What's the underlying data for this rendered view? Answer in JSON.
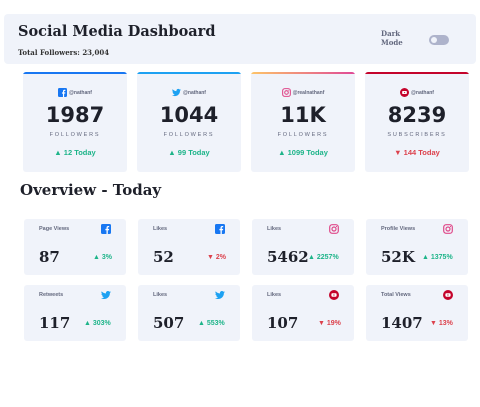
{
  "header": {
    "title": "Social Media Dashboard",
    "total_followers": "Total Followers: 23,004",
    "dark_mode_label": "Dark Mode"
  },
  "colors": {
    "facebook": "#1877f2",
    "twitter": "#1da1f2",
    "instagram": "#df4a8a",
    "youtube": "#c4032b",
    "up": "#1db489",
    "down": "#dc414c",
    "card_bg": "#f0f3fa"
  },
  "cards": [
    {
      "network": "facebook",
      "icon": "facebook-icon",
      "handle": "@nathanf",
      "count": "1987",
      "unit": "FOLLOWERS",
      "change": "▲ 12 Today",
      "trend": "up"
    },
    {
      "network": "twitter",
      "icon": "twitter-icon",
      "handle": "@nathanf",
      "count": "1044",
      "unit": "FOLLOWERS",
      "change": "▲ 99 Today",
      "trend": "up"
    },
    {
      "network": "instagram",
      "icon": "instagram-icon",
      "handle": "@realnathanf",
      "count": "11K",
      "unit": "FOLLOWERS",
      "change": "▲ 1099 Today",
      "trend": "up"
    },
    {
      "network": "youtube",
      "icon": "youtube-icon",
      "handle": "@nathanf",
      "count": "8239",
      "unit": "SUBSCRIBERS",
      "change": "▼ 144 Today",
      "trend": "down"
    }
  ],
  "overview": {
    "title": "Overview - Today",
    "tiles": [
      {
        "label": "Page Views",
        "icon": "facebook-icon",
        "value": "87",
        "change": "▲ 3%",
        "trend": "up"
      },
      {
        "label": "Likes",
        "icon": "facebook-icon",
        "value": "52",
        "change": "▼ 2%",
        "trend": "down"
      },
      {
        "label": "Likes",
        "icon": "instagram-icon",
        "value": "5462",
        "change": "▲ 2257%",
        "trend": "up"
      },
      {
        "label": "Profile Views",
        "icon": "instagram-icon",
        "value": "52K",
        "change": "▲ 1375%",
        "trend": "up"
      },
      {
        "label": "Retweets",
        "icon": "twitter-icon",
        "value": "117",
        "change": "▲ 303%",
        "trend": "up"
      },
      {
        "label": "Likes",
        "icon": "twitter-icon",
        "value": "507",
        "change": "▲ 553%",
        "trend": "up"
      },
      {
        "label": "Likes",
        "icon": "youtube-icon",
        "value": "107",
        "change": "▼ 19%",
        "trend": "down"
      },
      {
        "label": "Total Views",
        "icon": "youtube-icon",
        "value": "1407",
        "change": "▼ 13%",
        "trend": "down"
      }
    ]
  }
}
